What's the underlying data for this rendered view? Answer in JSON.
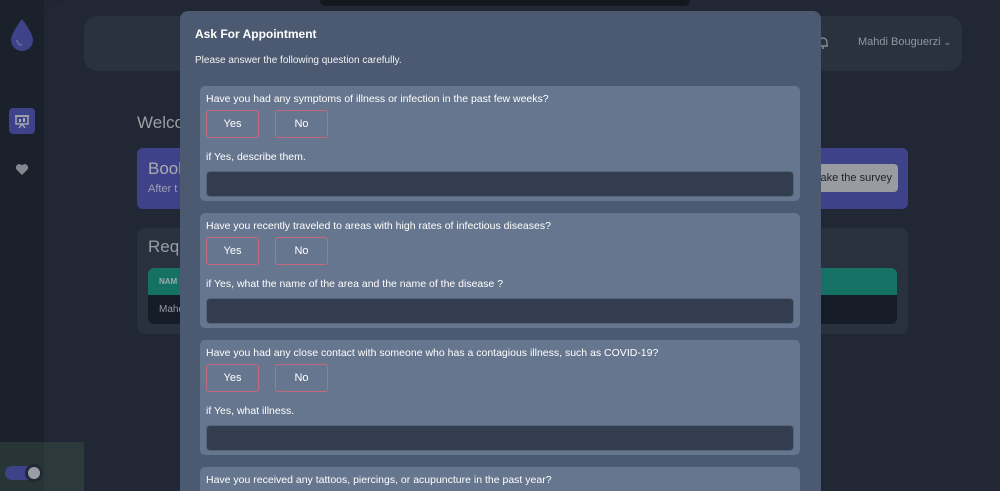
{
  "sidebar": {
    "items": [
      {
        "icon": "presentation-icon"
      },
      {
        "icon": "heart-icon"
      }
    ]
  },
  "header": {
    "user_name": "Mahdi Bouguerzi"
  },
  "dashboard": {
    "welcome": "Welco",
    "book": {
      "title": "Book",
      "subtitle": "After t",
      "button": "ake the survey"
    },
    "requests": {
      "title": "Requ",
      "col_header": "NAM",
      "row_value": "Mahd"
    }
  },
  "modal": {
    "title": "Ask For Appointment",
    "subtitle": "Please answer the following question carefully.",
    "yes_label": "Yes",
    "no_label": "No",
    "questions": [
      {
        "text": "Have you had any symptoms of illness or infection in the past few weeks?",
        "detail": "if Yes, describe them."
      },
      {
        "text": "Have you recently traveled to areas with high rates of infectious diseases?",
        "detail": "if Yes, what the name of the area and the name of the disease ?"
      },
      {
        "text": "Have you had any close contact with someone who has a contagious illness, such as COVID-19?",
        "detail": "if Yes, what illness."
      },
      {
        "text": "Have you received any tattoos, piercings, or acupuncture in the past year?"
      }
    ]
  },
  "colors": {
    "accent": "#5b5fc7",
    "table_header": "#1ea68f",
    "modal_bg": "#4b5a70",
    "question_bg": "#66768e",
    "option_border": "#c46a7e"
  }
}
